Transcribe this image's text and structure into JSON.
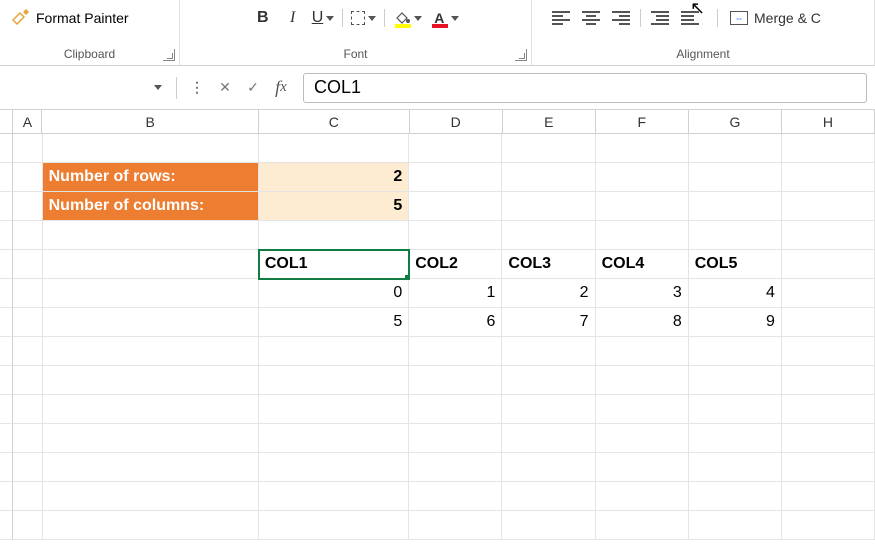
{
  "ribbon": {
    "clipboard": {
      "format_painter": "Format Painter",
      "group_label": "Clipboard"
    },
    "font": {
      "group_label": "Font",
      "bold": "B",
      "italic": "I",
      "underline": "U",
      "fill_letter": "A",
      "font_color_letter": "A"
    },
    "alignment": {
      "group_label": "Alignment",
      "merge_label": "Merge & C"
    }
  },
  "formula_bar": {
    "name_box": "",
    "x": "✕",
    "check": "✓",
    "value": "COL1"
  },
  "columns": [
    "A",
    "B",
    "C",
    "D",
    "E",
    "F",
    "G",
    "H"
  ],
  "cells": {
    "labels": {
      "rows_label": "Number of rows:",
      "cols_label": "Number of columns:"
    },
    "values": {
      "rows_value": "2",
      "cols_value": "5"
    },
    "headers": [
      "COL1",
      "COL2",
      "COL3",
      "COL4",
      "COL5"
    ],
    "data": [
      [
        "0",
        "1",
        "2",
        "3",
        "4"
      ],
      [
        "5",
        "6",
        "7",
        "8",
        "9"
      ]
    ]
  }
}
